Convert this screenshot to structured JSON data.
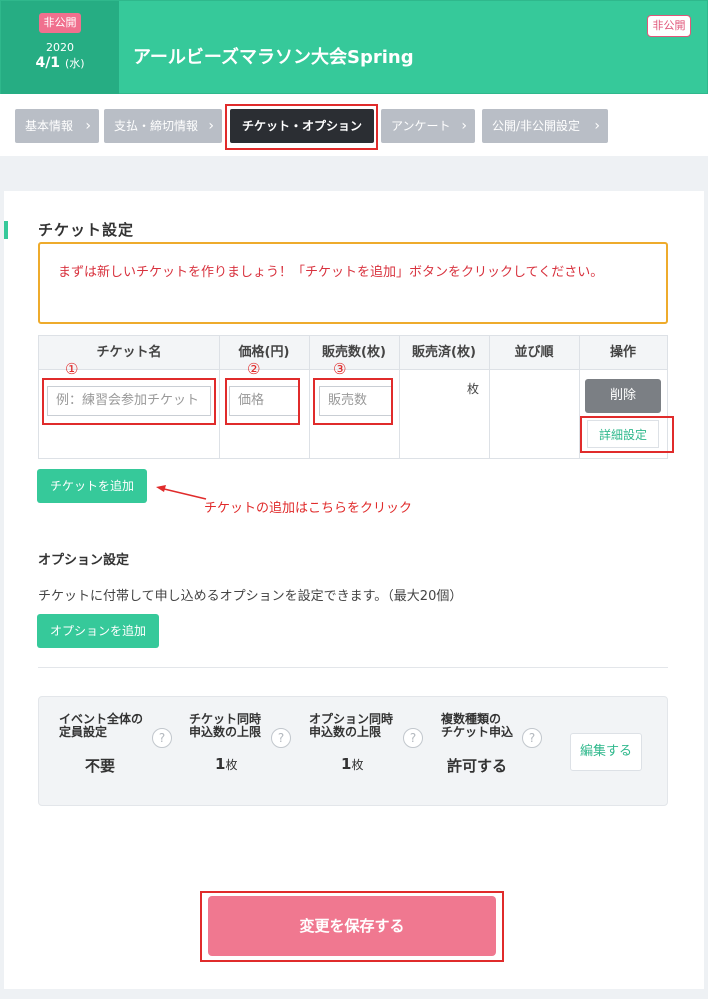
{
  "header": {
    "status_badge": "非公開",
    "year": "2020",
    "date": "4/1",
    "weekday": "(水)",
    "event_title": "アールビーズマラソン大会Spring",
    "visibility_badge": "非公開"
  },
  "tabs": [
    {
      "label": "基本情報",
      "active": false
    },
    {
      "label": "支払・締切情報",
      "active": false
    },
    {
      "label": "チケット・オプション",
      "active": true
    },
    {
      "label": "アンケート",
      "active": false
    },
    {
      "label": "公開/非公開設定",
      "active": false
    }
  ],
  "ticket_section": {
    "title": "チケット設定",
    "notice": "まずは新しいチケットを作りましょう！「チケットを追加」ボタンをクリックしてください。",
    "columns": [
      "チケット名",
      "価格(円)",
      "販売数(枚)",
      "販売済(枚)",
      "並び順",
      "操作"
    ],
    "row": {
      "name_placeholder": "例：練習会参加チケット",
      "price_placeholder": "価格",
      "qty_placeholder": "販売数",
      "sold_unit": "枚",
      "delete_label": "削除",
      "detail_label": "詳細設定"
    },
    "markers": [
      "①",
      "②",
      "③"
    ],
    "add_ticket_label": "チケットを追加",
    "add_ticket_note": "チケットの追加はこちらをクリック"
  },
  "option_section": {
    "title": "オプション設定",
    "description": "チケットに付帯して申し込めるオプションを設定できます。（最大20個）",
    "add_option_label": "オプションを追加"
  },
  "limits": {
    "items": [
      {
        "label_line1": "イベント全体の",
        "label_line2": "定員設定",
        "value": "不要",
        "unit": ""
      },
      {
        "label_line1": "チケット同時",
        "label_line2": "申込数の上限",
        "value": "1",
        "unit": "枚"
      },
      {
        "label_line1": "オプション同時",
        "label_line2": "申込数の上限",
        "value": "1",
        "unit": "枚"
      },
      {
        "label_line1": "複数種類の",
        "label_line2": "チケット申込",
        "value": "許可する",
        "unit": ""
      }
    ],
    "help_glyph": "?",
    "edit_label": "編集する"
  },
  "footer": {
    "save_label": "変更を保存する"
  },
  "icons": {
    "chevron": "›",
    "arrow": "←"
  },
  "colors": {
    "brand_green": "#36c99a",
    "accent_pink": "#f07890",
    "annotation_red": "#e02b2b",
    "notice_border": "#eeab2c"
  }
}
